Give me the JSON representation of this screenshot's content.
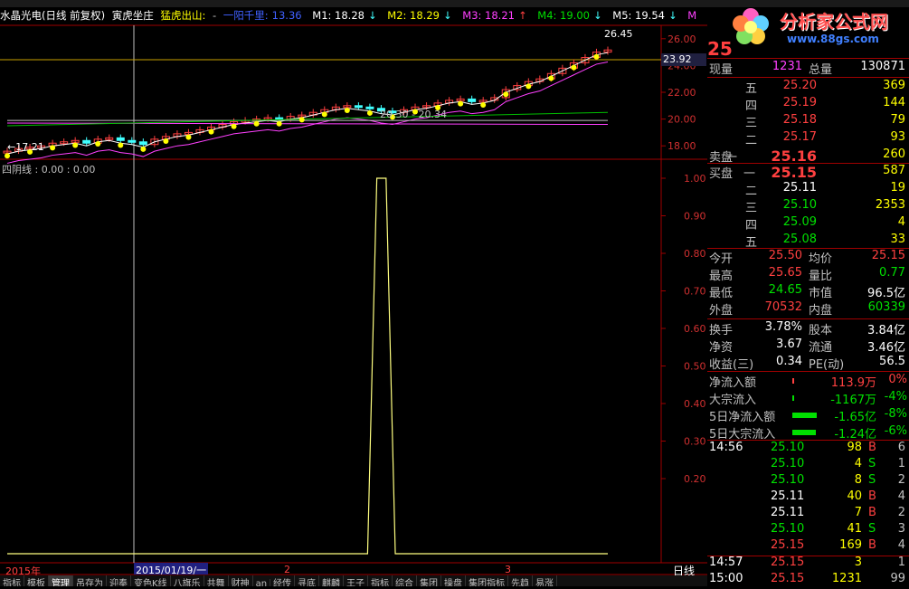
{
  "header": {
    "stock_name": "水晶光电(日线 前复权)",
    "indicator1": "寅虎坐庄",
    "indicator2": "猛虎出山:",
    "dash": "-",
    "line_label": "一阳千里:",
    "line_value": "13.36",
    "m1": "M1: 18.28",
    "m2": "M2: 18.29",
    "m3": "M3: 18.21",
    "m4": "M4: 19.00",
    "m5": "M5: 19.54",
    "m_more": "M",
    "arrow_down": "↓",
    "arrow_up": "↑"
  },
  "logo": {
    "title": "分析家公式网",
    "url": "www.88gs.com"
  },
  "upper_chart": {
    "high_label": "26.45",
    "low_label": "17.21",
    "ma_label": "20.30 - 20.34",
    "crosshair_price": "23.92",
    "y_ticks": [
      "26.00",
      "24.00",
      "22.00",
      "20.00",
      "18.00"
    ]
  },
  "lower_chart": {
    "title": "四阴线 : 0.00 : 0.00",
    "y_ticks": [
      "1.00",
      "0.90",
      "0.80",
      "0.70",
      "0.60",
      "0.50",
      "0.40",
      "0.30",
      "0.20"
    ]
  },
  "x_axis": {
    "year_label": "2015年",
    "cursor_date": "2015/01/19/一",
    "month2": "2",
    "month3": "3",
    "period": "日线"
  },
  "panel": {
    "price_big": "25",
    "volume_now_label": "现量",
    "volume_now": "1231",
    "volume_total_label": "总量",
    "volume_total": "130871",
    "sell": [
      {
        "label": "五",
        "price": "25.20",
        "qty": "369"
      },
      {
        "label": "四",
        "price": "25.19",
        "qty": "144"
      },
      {
        "label": "三",
        "price": "25.18",
        "qty": "79"
      },
      {
        "label": "二",
        "price": "25.17",
        "qty": "93"
      },
      {
        "label": "一",
        "price": "25.16",
        "qty": "260"
      }
    ],
    "sell_label": "卖盘",
    "buy_label": "买盘",
    "buy": [
      {
        "label": "一",
        "price": "25.15",
        "qty": "587"
      },
      {
        "label": "二",
        "price": "25.11",
        "qty": "19"
      },
      {
        "label": "三",
        "price": "25.10",
        "qty": "2353"
      },
      {
        "label": "四",
        "price": "25.09",
        "qty": "4"
      },
      {
        "label": "五",
        "price": "25.08",
        "qty": "33"
      }
    ],
    "stats": [
      {
        "l1": "今开",
        "v1": "25.50",
        "l2": "均价",
        "v2": "25.15"
      },
      {
        "l1": "最高",
        "v1": "25.65",
        "l2": "量比",
        "v2": "0.77"
      },
      {
        "l1": "最低",
        "v1": "24.65",
        "l2": "市值",
        "v2": "96.5亿"
      },
      {
        "l1": "外盘",
        "v1": "70532",
        "l2": "内盘",
        "v2": "60339"
      }
    ],
    "stats2": [
      {
        "l1": "换手",
        "v1": "3.78%",
        "l2": "股本",
        "v2": "3.84亿"
      },
      {
        "l1": "净资",
        "v1": "3.67",
        "l2": "流通",
        "v2": "3.46亿"
      },
      {
        "l1": "收益(三)",
        "v1": "0.34",
        "l2": "PE(动)",
        "v2": "56.5"
      }
    ],
    "flows": [
      {
        "label": "净流入额",
        "value": "113.9万",
        "pct": "0%",
        "bar": 0.02
      },
      {
        "label": "大宗流入",
        "value": "-1167万",
        "pct": "-4%",
        "bar": 0.03
      },
      {
        "label": "5日净流入额",
        "value": "-1.65亿",
        "pct": "-8%",
        "bar": 0.9
      },
      {
        "label": "5日大宗流入",
        "value": "-1.24亿",
        "pct": "-6%",
        "bar": 0.85
      }
    ],
    "ticks": [
      {
        "time": "14:56",
        "price": "25.10",
        "vol": "98",
        "bs": "B",
        "n": "6"
      },
      {
        "time": "",
        "price": "25.10",
        "vol": "4",
        "bs": "S",
        "n": "1"
      },
      {
        "time": "",
        "price": "25.10",
        "vol": "8",
        "bs": "S",
        "n": "2"
      },
      {
        "time": "",
        "price": "25.11",
        "vol": "40",
        "bs": "B",
        "n": "4"
      },
      {
        "time": "",
        "price": "25.11",
        "vol": "7",
        "bs": "B",
        "n": "2"
      },
      {
        "time": "",
        "price": "25.10",
        "vol": "41",
        "bs": "S",
        "n": "3"
      },
      {
        "time": "",
        "price": "25.15",
        "vol": "169",
        "bs": "B",
        "n": "4"
      },
      {
        "time": "14:57",
        "price": "25.15",
        "vol": "3",
        "bs": "",
        "n": "1"
      },
      {
        "time": "15:00",
        "price": "25.15",
        "vol": "1231",
        "bs": "",
        "n": "99"
      }
    ]
  },
  "bottom_tabs": [
    "指标",
    "模板",
    "管理",
    "吊存为",
    "迎奉",
    "变色K线",
    "八旗乐",
    "共舞",
    "财神",
    "an",
    "经传",
    "寻底",
    "麒麟",
    "王子",
    "指标",
    "综合",
    "集团",
    "操盘",
    "集团指标",
    "先趋",
    "易涨"
  ],
  "colors": {
    "up": "#ff4040",
    "down": "#40ffff",
    "ma_yellow": "#ffff00",
    "border": "#a00000"
  },
  "chart_data": [
    {
      "type": "candlestick",
      "title": "",
      "ylim": [
        17,
        27
      ],
      "x_labels": [
        "2015年",
        "2",
        "3"
      ],
      "close": [
        17.6,
        17.8,
        17.9,
        18.0,
        18.2,
        18.3,
        18.4,
        18.2,
        18.5,
        18.6,
        18.4,
        18.3,
        18.1,
        18.5,
        18.7,
        18.9,
        19.0,
        19.2,
        19.4,
        19.6,
        19.8,
        19.9,
        20.0,
        20.1,
        20.0,
        20.2,
        20.3,
        20.5,
        20.7,
        20.9,
        21.0,
        20.9,
        20.8,
        20.6,
        20.5,
        20.7,
        20.9,
        21.0,
        21.2,
        21.4,
        21.5,
        21.3,
        21.4,
        21.6,
        22.2,
        22.5,
        22.8,
        23.0,
        23.4,
        23.8,
        24.2,
        24.6,
        25.0,
        25.16
      ]
    },
    {
      "type": "line",
      "title": "四阴线",
      "ylim": [
        0,
        1
      ],
      "values": [
        0,
        0,
        0,
        0,
        0,
        0,
        0,
        0,
        0,
        0,
        0,
        0,
        0,
        0,
        0,
        0,
        0,
        0,
        0,
        0,
        0,
        0,
        0,
        0,
        0,
        0,
        0,
        0,
        0,
        0,
        0,
        0,
        0,
        0,
        0,
        0,
        0,
        0,
        0,
        0,
        1,
        1,
        0,
        0,
        0,
        0,
        0,
        0,
        0,
        0,
        0,
        0,
        0,
        0,
        0,
        0,
        0,
        0,
        0,
        0,
        0,
        0,
        0,
        0,
        0,
        0
      ]
    }
  ]
}
